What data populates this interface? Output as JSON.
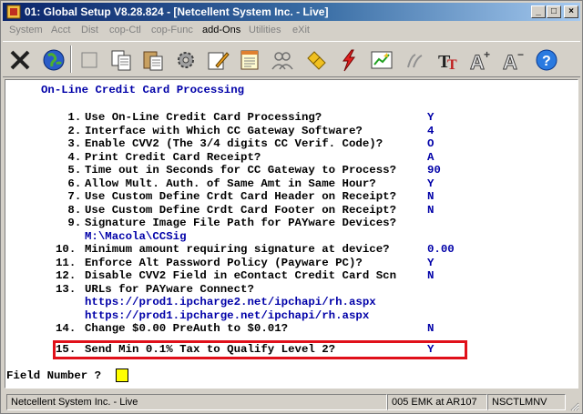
{
  "window": {
    "title": "01: Global Setup V8.28.824 - [Netcellent System Inc. - Live]",
    "minimize_glyph": "_",
    "maximize_glyph": "□",
    "close_glyph": "×"
  },
  "menu": [
    {
      "label": "System",
      "enabled": false
    },
    {
      "label": "Acct",
      "enabled": false
    },
    {
      "label": "Dist",
      "enabled": false
    },
    {
      "label": "cop-Ctl",
      "enabled": false
    },
    {
      "label": "cop-Func",
      "enabled": false
    },
    {
      "label": "add-Ons",
      "enabled": true
    },
    {
      "label": "Utilities",
      "enabled": false
    },
    {
      "label": "eXit",
      "enabled": false
    }
  ],
  "toolbar": [
    {
      "icon": "close-x-icon"
    },
    {
      "icon": "globe-icon"
    },
    {
      "icon": "blank-icon"
    },
    {
      "icon": "copy-icon"
    },
    {
      "icon": "paste-icon"
    },
    {
      "icon": "settings-icon"
    },
    {
      "icon": "edit-icon"
    },
    {
      "icon": "notes-icon"
    },
    {
      "icon": "users-icon"
    },
    {
      "icon": "link-icon"
    },
    {
      "icon": "lightning-icon"
    },
    {
      "icon": "chart-icon"
    },
    {
      "icon": "script-icon"
    },
    {
      "icon": "font-icon"
    },
    {
      "icon": "font-larger-icon"
    },
    {
      "icon": "font-smaller-icon"
    },
    {
      "icon": "help-icon"
    }
  ],
  "screen": {
    "heading": "On-Line Credit Card Processing",
    "items": [
      {
        "num": " 1.",
        "label": "Use On-Line Credit Card Processing?",
        "value": "Y"
      },
      {
        "num": " 2.",
        "label": "Interface with Which CC Gateway Software?",
        "value": "4"
      },
      {
        "num": " 3.",
        "label": "Enable CVV2 (The 3/4 digits CC Verif. Code)?",
        "value": "O"
      },
      {
        "num": " 4.",
        "label": "Print Credit Card Receipt?",
        "value": "A"
      },
      {
        "num": " 5.",
        "label": "Time out in Seconds for CC Gateway to Process?",
        "value": "90"
      },
      {
        "num": " 6.",
        "label": "Allow Mult. Auth. of Same Amt in Same Hour?",
        "value": "Y"
      },
      {
        "num": " 7.",
        "label": "Use Custom Define Crdt Card Header on Receipt?",
        "value": "N"
      },
      {
        "num": " 8.",
        "label": "Use Custom Define Crdt Card Footer on Receipt?",
        "value": "N"
      },
      {
        "num": " 9.",
        "label": "Signature Image File Path for PAYware Devices?",
        "value": "M:\\Macola\\CCSig"
      },
      {
        "num": "10.",
        "label": "Minimum amount requiring signature at device?",
        "value": "0.00"
      },
      {
        "num": "11.",
        "label": "Enforce Alt Password Policy (Payware PC)?",
        "value": "Y"
      },
      {
        "num": "12.",
        "label": "Disable CVV2 Field in eContact Credit Card Scn",
        "value": "N"
      },
      {
        "num": "13.",
        "label": "URLs for PAYware Connect?",
        "value": "https://prod1.ipcharge2.net/ipchapi/rh.aspx",
        "value2": "https://prod1.ipcharge.net/ipchapi/rh.aspx"
      },
      {
        "num": "14.",
        "label": "Change $0.00 PreAuth to $0.01?",
        "value": "N"
      },
      {
        "num": "15.",
        "label": "Send Min 0.1% Tax to Qualify Level 2?",
        "value": "Y"
      }
    ],
    "prompt": "Field Number ?"
  },
  "status": {
    "company": "Netcellent System Inc. - Live",
    "session": "005 EMK at AR107",
    "machine": "NSCTLMNV"
  }
}
